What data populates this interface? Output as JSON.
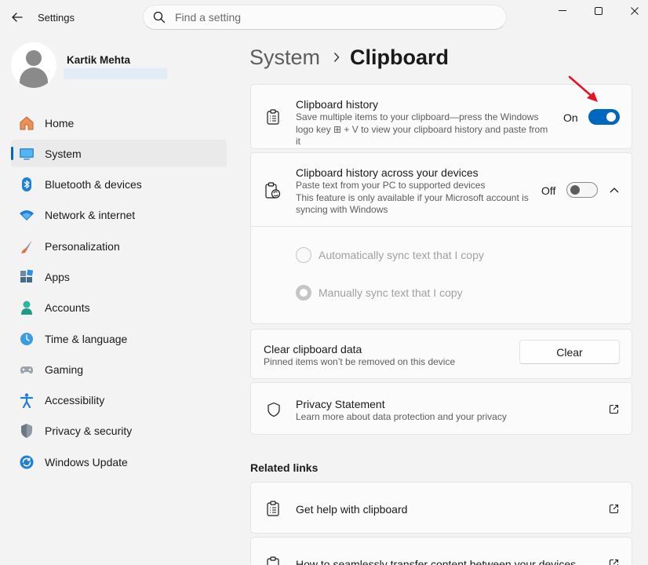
{
  "window": {
    "title": "Settings",
    "controls": [
      "minimize",
      "maximize",
      "close"
    ]
  },
  "search": {
    "placeholder": "Find a setting",
    "value": ""
  },
  "user": {
    "name": "Kartik Mehta",
    "email": ""
  },
  "sidebar": {
    "active": "System",
    "items": [
      {
        "label": "Home",
        "icon": "home-icon"
      },
      {
        "label": "System",
        "icon": "system-icon"
      },
      {
        "label": "Bluetooth & devices",
        "icon": "bluetooth-icon"
      },
      {
        "label": "Network & internet",
        "icon": "wifi-icon"
      },
      {
        "label": "Personalization",
        "icon": "brush-icon"
      },
      {
        "label": "Apps",
        "icon": "apps-icon"
      },
      {
        "label": "Accounts",
        "icon": "accounts-icon"
      },
      {
        "label": "Time & language",
        "icon": "time-language-icon"
      },
      {
        "label": "Gaming",
        "icon": "gamepad-icon"
      },
      {
        "label": "Accessibility",
        "icon": "accessibility-icon"
      },
      {
        "label": "Privacy & security",
        "icon": "shield-icon"
      },
      {
        "label": "Windows Update",
        "icon": "update-icon"
      }
    ]
  },
  "breadcrumb": {
    "parent": "System",
    "current": "Clipboard"
  },
  "clipboard_history": {
    "title": "Clipboard history",
    "description": "Save multiple items to your clipboard—press the Windows logo key ⊞ + V to view your clipboard history and paste from it",
    "toggle_label": "On",
    "toggle_state": true
  },
  "cross_device": {
    "title": "Clipboard history across your devices",
    "description_line1": "Paste text from your PC to supported devices",
    "description_line2": "This feature is only available if your Microsoft account is syncing with Windows",
    "toggle_label": "Off",
    "toggle_state": false,
    "expanded": true,
    "options": [
      {
        "label": "Automatically sync text that I copy"
      },
      {
        "label": "Manually sync text that I copy"
      }
    ]
  },
  "clear_data": {
    "title": "Clear clipboard data",
    "description": "Pinned items won’t be removed on this device",
    "button_label": "Clear"
  },
  "privacy": {
    "title": "Privacy Statement",
    "description": "Learn more about data protection and your privacy"
  },
  "related_links": {
    "heading": "Related links",
    "items": [
      {
        "label": "Get help with clipboard"
      },
      {
        "label": "How to seamlessly transfer content between your devices"
      }
    ]
  },
  "colors": {
    "accent": "#0067c0",
    "background": "#f3f3f3",
    "card": "#fbfbfb",
    "annotation": "#e81123"
  }
}
